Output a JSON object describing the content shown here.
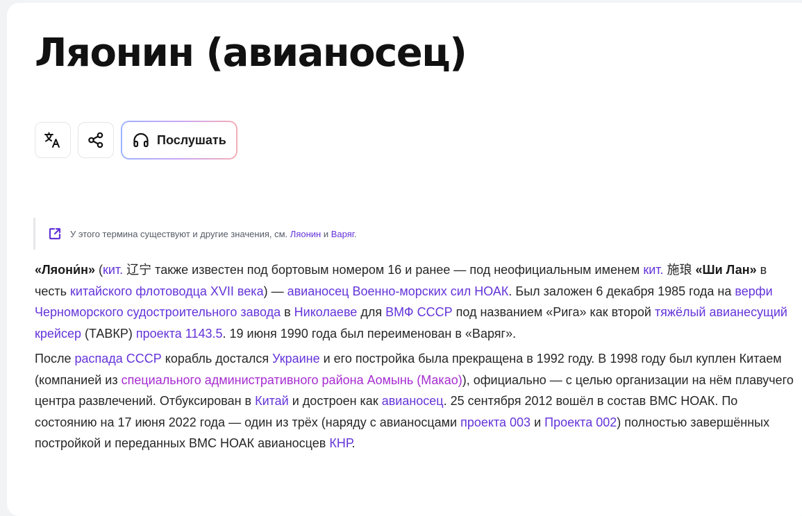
{
  "page": {
    "title": "Ляонин (авианосец)"
  },
  "actions": {
    "translate_icon": "translate-icon",
    "share_icon": "share-icon",
    "listen_icon": "headphones-icon",
    "listen_label": "Послушать"
  },
  "notice": {
    "icon": "external-link-icon",
    "text_before": "У этого термина существуют и другие значения, см.",
    "link1": "Ляонин",
    "and": "и",
    "link2": "Варяг",
    "end": "."
  },
  "paragraph1": {
    "s0": "«Ляони́н»",
    "s1": " (",
    "l1": "кит.",
    "s2": " 辽宁 также известен под бортовым номером 16 и ранее — под неофициальным именем ",
    "l2": "кит.",
    "s3": " 施琅 ",
    "b2": "«Ши Лан»",
    "s4": " в честь ",
    "l3": "китайского флотоводца XVII века",
    "s5": ") — ",
    "l4": "авианосец Военно-морских сил НОАК",
    "s6": ". Был заложен 6 декабря 1985 года на ",
    "l5": "верфи Черноморского судостроительного завода",
    "s7": " в ",
    "l6": "Николаеве",
    "s8": " для ",
    "l7": "ВМФ СССР",
    "s9": " под названием «Рига» как второй ",
    "l8": "тяжёлый авианесущий крейсер",
    "s10": " (ТАВКР) ",
    "l9": "проекта 1143.5",
    "s11": ". 19 июня 1990 года был переименован в «Варяг»."
  },
  "paragraph2": {
    "s0": "После ",
    "l1": "распада СССР",
    "s1": " корабль достался ",
    "l2": "Украине",
    "s2": " и его постройка была прекращена в 1992 году. В 1998 году был куплен Китаем (компанией из ",
    "l3": "специального административного района Аомынь (Макао)",
    "s3": "), официально — с целью организации на нём плавучего центра развлечений. Отбуксирован в ",
    "l4": "Китай",
    "s4": " и достроен как ",
    "l5": "авианосец",
    "s5": ". 25 сентября 2012 вошёл в состав ВМС НОАК. По состоянию на 17 июня 2022 года — один из трёх (наряду с авианосцами ",
    "l6": "проекта 003",
    "s6": " и ",
    "l7": "Проекта 002",
    "s7": ") полностью завершённых постройкой и переданных ВМС НОАК авианосцев ",
    "l8": "КНР",
    "s8": "."
  },
  "colors": {
    "link": "#6434d9",
    "link_visited": "#a62bd0",
    "text": "#262626"
  }
}
